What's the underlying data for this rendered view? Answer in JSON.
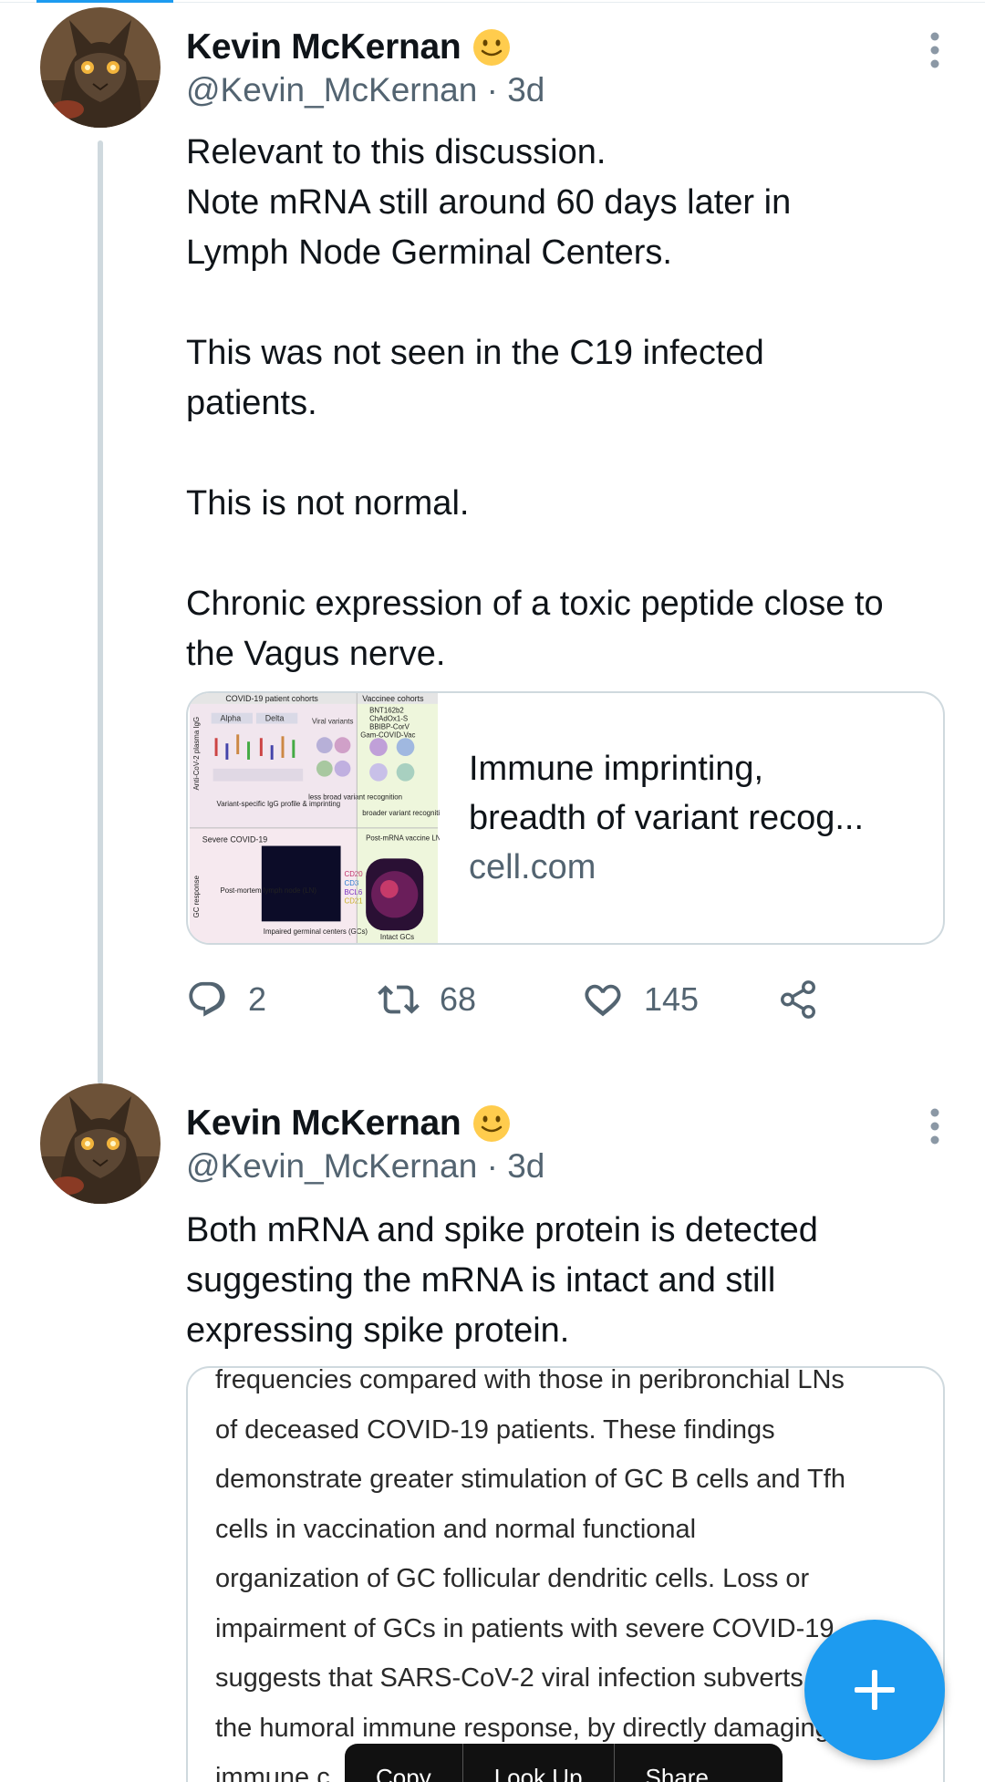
{
  "tweets": [
    {
      "author_name": "Kevin McKernan",
      "handle_time": "@Kevin_McKernan · 3d",
      "emoji": "slightly-smiling-face",
      "text_blocks": [
        [
          "Relevant to this discussion.",
          "Note mRNA still around 60 days later in",
          "Lymph Node Germinal Centers."
        ],
        [
          "This was not seen in the C19 infected",
          "patients."
        ],
        [
          "This is not normal."
        ],
        [
          "Chronic expression of a toxic peptide close to",
          "the Vagus nerve."
        ]
      ],
      "link_card": {
        "title_line1": "Immune imprinting,",
        "title_line2": "breadth of variant recog...",
        "domain": "cell.com",
        "thumb": {
          "col_left_header": "COVID-19 patient cohorts",
          "col_right_header": "Vaccinee cohorts",
          "alpha": "Alpha",
          "delta": "Delta",
          "viral_variants": "Viral variants",
          "vaccines": [
            "BNT162b2",
            "ChAdOx1-S",
            "BBIBP-CorV",
            "Gam-COVID-Vac"
          ],
          "variant_specific": "Variant-specific IgG profile & imprinting",
          "less_broad": "less broad variant recognition",
          "broader": "broader variant recognition",
          "severe": "Severe COVID-19",
          "post_mrna": "Post-mRNA vaccine LN",
          "post_mortem": "Post-mortem lymph node (LN)",
          "impaired": "Impaired germinal centers (GCs)",
          "intact": "Intact GCs",
          "markers": [
            "CD20",
            "CD3",
            "BCL6",
            "CD21"
          ],
          "side_label_top": "Anti-CoV-2 plasma IgG",
          "side_label_bottom": "GC response"
        }
      },
      "actions": {
        "replies": "2",
        "retweets": "68",
        "likes": "145"
      }
    },
    {
      "author_name": "Kevin McKernan",
      "handle_time": "@Kevin_McKernan · 3d",
      "emoji": "slightly-smiling-face",
      "text_lines": [
        "Both mRNA and spike protein is detected",
        "suggesting the mRNA is intact and still",
        "expressing spike protein."
      ],
      "quote_lines": [
        "frequencies compared with those in peribronchial LNs",
        "of deceased COVID-19 patients. These findings",
        "demonstrate greater stimulation of GC B cells and Tfh",
        "cells in vaccination and normal functional",
        "organization of GC follicular dendritic cells. Loss or",
        "impairment of GCs in patients with severe COVID-19",
        "suggests that SARS-CoV-2 viral infection subverts",
        "the humoral immune response, by directly damaging",
        "immune c"
      ]
    }
  ],
  "text_selection_menu": [
    "Copy",
    "Look Up",
    "Share"
  ],
  "fab": {
    "icon": "plus-icon"
  },
  "colors": {
    "accent": "#1d9bf0",
    "text": "#0f1419",
    "secondary": "#536471",
    "border": "#cfd9de"
  }
}
